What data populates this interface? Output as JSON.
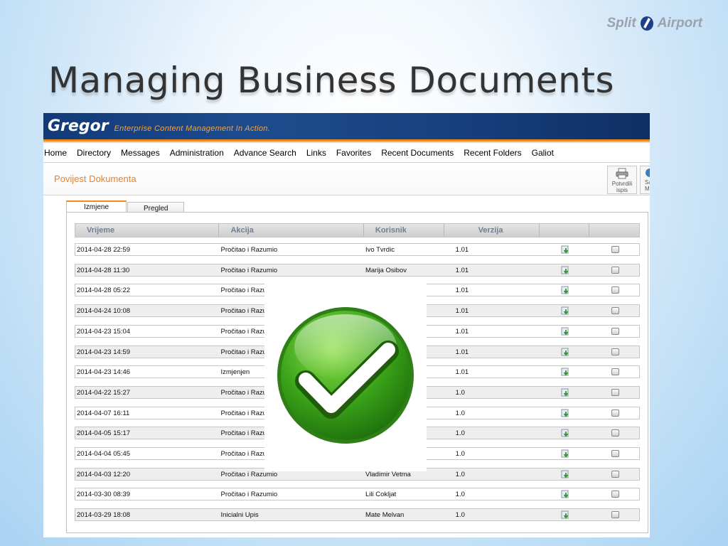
{
  "logo": {
    "left": "Split",
    "right": "Airport"
  },
  "slide_title": "Managing Business Documents",
  "app": {
    "brand": "Gregor",
    "tagline": "Enterprise Content Management In Action.",
    "menu": [
      "Home",
      "Directory",
      "Messages",
      "Administration",
      "Advance Search",
      "Links",
      "Favorites",
      "Recent Documents",
      "Recent Folders",
      "Galiot"
    ],
    "page_title": "Povijest Dokumenta",
    "print_button": {
      "line1": "Potvrdili",
      "line2": "ispis"
    },
    "save_button": {
      "line1": "Sa",
      "line2": "Mi"
    },
    "tabs": [
      {
        "label": "Izmjene",
        "active": true
      },
      {
        "label": "Pregled",
        "active": false
      }
    ],
    "table": {
      "columns": [
        "Vrijeme",
        "Akcija",
        "Korisnik",
        "Verzija",
        "",
        ""
      ],
      "rows": [
        {
          "time": "2014-04-28 22:59",
          "action": "Pročitao i Razumio",
          "user": "Ivo Tvrdic",
          "version": "1.01"
        },
        {
          "time": "2014-04-28 11:30",
          "action": "Pročitao i Razumio",
          "user": "Marija Osibov",
          "version": "1.01"
        },
        {
          "time": "2014-04-28 05:22",
          "action": "Pročitao i Razumio",
          "user": "",
          "version": "1.01"
        },
        {
          "time": "2014-04-24 10:08",
          "action": "Pročitao i Razumio",
          "user": "",
          "version": "1.01"
        },
        {
          "time": "2014-04-23 15:04",
          "action": "Pročitao i Razumio",
          "user": "",
          "version": "1.01"
        },
        {
          "time": "2014-04-23 14:59",
          "action": "Pročitao i Razumio",
          "user": "",
          "version": "1.01"
        },
        {
          "time": "2014-04-23 14:46",
          "action": "Izmjenjen",
          "user": "",
          "version": "1.01"
        },
        {
          "time": "2014-04-22 15:27",
          "action": "Pročitao i Razumio",
          "user": "",
          "version": "1.0"
        },
        {
          "time": "2014-04-07 16:11",
          "action": "Pročitao i Razumio",
          "user": "",
          "version": "1.0"
        },
        {
          "time": "2014-04-05 15:17",
          "action": "Pročitao i Razumio",
          "user": "",
          "version": "1.0"
        },
        {
          "time": "2014-04-04 05:45",
          "action": "Pročitao i Razumio",
          "user": "",
          "version": "1.0"
        },
        {
          "time": "2014-04-03 12:20",
          "action": "Pročitao i Razumio",
          "user": "Vladimir Vetma",
          "version": "1.0"
        },
        {
          "time": "2014-03-30 08:39",
          "action": "Pročitao i Razumio",
          "user": "Lili Cokljat",
          "version": "1.0"
        },
        {
          "time": "2014-03-29 18:08",
          "action": "Inicialni Upis",
          "user": "Mate Melvan",
          "version": "1.0"
        }
      ]
    }
  },
  "icons": {
    "row_action_1": "download-icon",
    "row_action_2": "checkbox-icon",
    "overlay": "green-checkmark-icon"
  }
}
